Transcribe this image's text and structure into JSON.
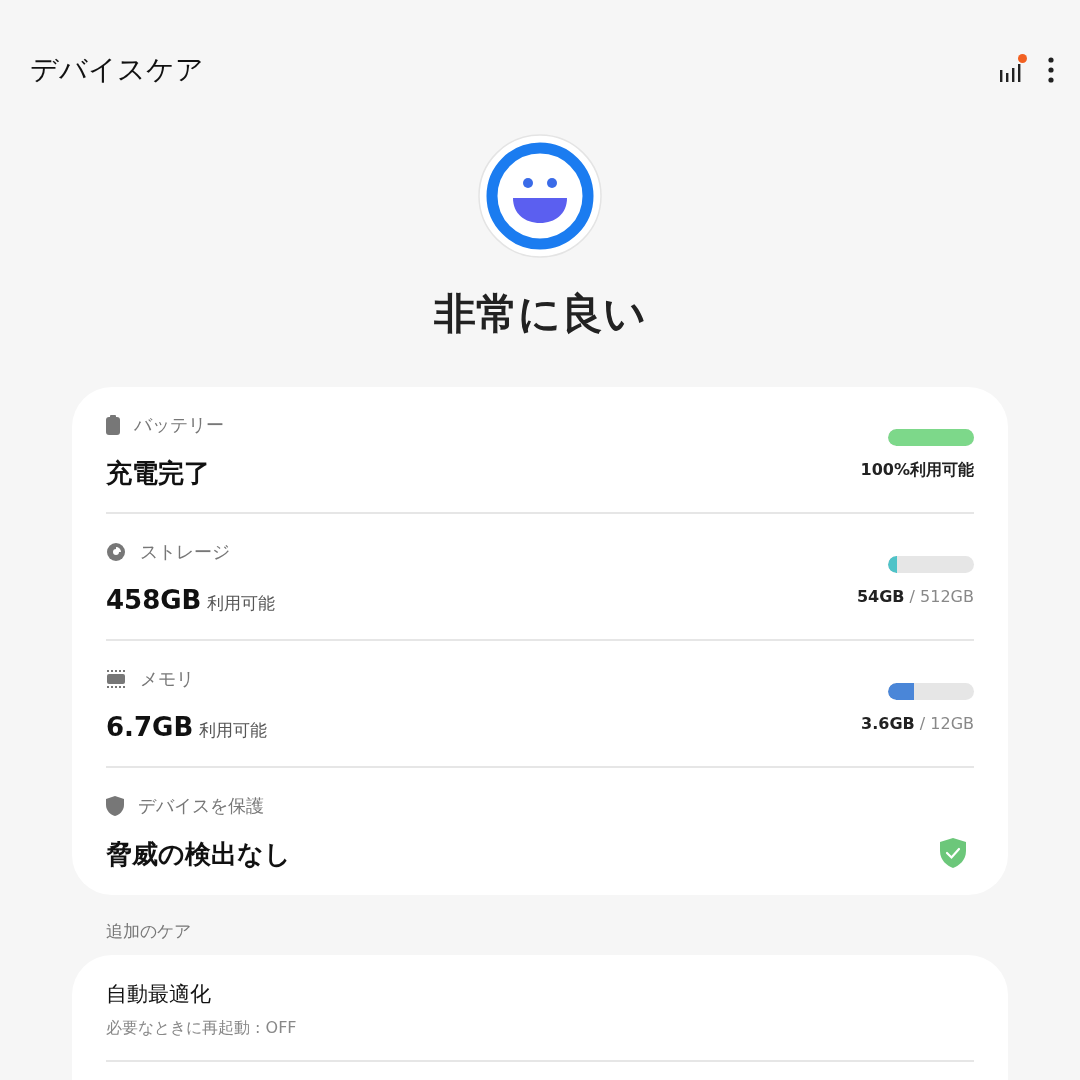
{
  "header": {
    "title": "デバイスケア",
    "notification_dot": true
  },
  "status": {
    "label": "非常に良い"
  },
  "items": [
    {
      "kind": "battery",
      "label": "バッテリー",
      "value": "充電完了",
      "level": 1,
      "color": "#7dd88a",
      "reading": "100%利用可能"
    },
    {
      "kind": "storage",
      "label": "ストレージ",
      "value": "458GB",
      "unit": "利用可能",
      "level": 0.1,
      "color": "#4fc3c8",
      "reading": "**54GB** / 512GB"
    },
    {
      "kind": "memory",
      "label": "メモリ",
      "value": "6.7GB",
      "unit": "利用可能",
      "level": 0.3,
      "color": "#4a86d8",
      "reading": "**3.6GB** / 12GB"
    },
    {
      "kind": "security",
      "label": "デバイスを保護",
      "value": "脅威の検出なし"
    }
  ],
  "extra": {
    "heading": "追加のケア",
    "items": [
      {
        "title": "自動最適化",
        "subtitle": "必要なときに再起動 : OFF"
      }
    ]
  }
}
